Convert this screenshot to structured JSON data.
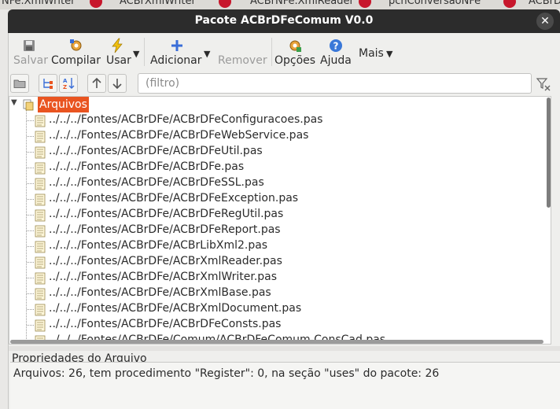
{
  "background_tabs": [
    "NFe.XmlWriter",
    "ACBrXmlWriter",
    "ACBrNFe.XmlReader",
    "pcnConversaoNFe",
    "ACBrD"
  ],
  "window": {
    "title": "Pacote ACBrDFeComum V0.0"
  },
  "toolbar": {
    "save": "Salvar",
    "compile": "Compilar",
    "use": "Usar",
    "add": "Adicionar",
    "remove": "Remover",
    "options": "Opções",
    "help": "Ajuda",
    "more": "Mais"
  },
  "filter": {
    "placeholder": "(filtro)"
  },
  "tree": {
    "root": "Arquivos",
    "files": [
      "../../../Fontes/ACBrDFe/ACBrDFeConfiguracoes.pas",
      "../../../Fontes/ACBrDFe/ACBrDFeWebService.pas",
      "../../../Fontes/ACBrDFe/ACBrDFeUtil.pas",
      "../../../Fontes/ACBrDFe/ACBrDFe.pas",
      "../../../Fontes/ACBrDFe/ACBrDFeSSL.pas",
      "../../../Fontes/ACBrDFe/ACBrDFeException.pas",
      "../../../Fontes/ACBrDFe/ACBrDFeRegUtil.pas",
      "../../../Fontes/ACBrDFe/ACBrDFeReport.pas",
      "../../../Fontes/ACBrDFe/ACBrLibXml2.pas",
      "../../../Fontes/ACBrDFe/ACBrXmlReader.pas",
      "../../../Fontes/ACBrDFe/ACBrXmlWriter.pas",
      "../../../Fontes/ACBrDFe/ACBrXmlBase.pas",
      "../../../Fontes/ACBrDFe/ACBrXmlDocument.pas",
      "../../../Fontes/ACBrDFe/ACBrDFeConsts.pas",
      "../../../Fontes/ACBrDFe/Comum/ACBrDFeComum.ConsCad.pas"
    ]
  },
  "properties": {
    "title": "Propriedades do Arquivo",
    "summary": "Arquivos: 26, tem procedimento \"Register\": 0, na seção \"uses\" do pacote: 26"
  },
  "colors": {
    "selection": "#e95420",
    "titlebar": "#2c2c2c",
    "tab_close": "#c7162b"
  }
}
